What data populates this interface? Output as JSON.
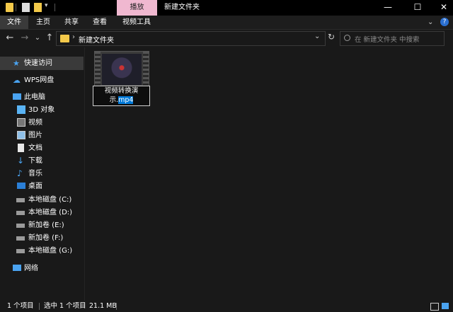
{
  "window": {
    "context_tab": "播放",
    "title": "新建文件夹",
    "minimize": "—",
    "maximize": "☐",
    "close": "✕"
  },
  "ribbon": {
    "tabs": [
      {
        "label": "文件",
        "active": true
      },
      {
        "label": "主页"
      },
      {
        "label": "共享"
      },
      {
        "label": "查看"
      },
      {
        "label": "视频工具"
      }
    ],
    "help": "?"
  },
  "address": {
    "back": "←",
    "forward": "→",
    "dropdown": "⌄",
    "up": "↑",
    "sep": "›",
    "path": "新建文件夹",
    "dropdown2": "⌄",
    "refresh": "↻",
    "search_placeholder": "在 新建文件夹 中搜索"
  },
  "sidebar": {
    "items": [
      {
        "label": "快速访问",
        "icon": "star-icon"
      },
      {
        "label": "WPS网盘",
        "icon": "cloud-icon"
      },
      {
        "label": "此电脑",
        "icon": "computer-icon"
      },
      {
        "label": "3D 对象",
        "icon": "cube-icon"
      },
      {
        "label": "视频",
        "icon": "video-icon"
      },
      {
        "label": "图片",
        "icon": "picture-icon"
      },
      {
        "label": "文档",
        "icon": "document-icon"
      },
      {
        "label": "下载",
        "icon": "download-icon"
      },
      {
        "label": "音乐",
        "icon": "music-icon"
      },
      {
        "label": "桌面",
        "icon": "desktop-icon"
      },
      {
        "label": "本地磁盘 (C:)",
        "icon": "drive-icon"
      },
      {
        "label": "本地磁盘 (D:)",
        "icon": "drive-icon"
      },
      {
        "label": "新加卷 (E:)",
        "icon": "drive-icon"
      },
      {
        "label": "新加卷 (F:)",
        "icon": "drive-icon"
      },
      {
        "label": "本地磁盘 (G:)",
        "icon": "drive-icon"
      },
      {
        "label": "网络",
        "icon": "network-icon"
      }
    ]
  },
  "file": {
    "name_line1": "视频转换演",
    "name_line2_plain": "示.",
    "name_line2_selected": "mp4"
  },
  "status": {
    "count": "1 个项目",
    "selected": "选中 1 个项目",
    "size": "21.1 MB"
  },
  "colors": {
    "accent": "#0078d7",
    "context_tab": "#f0b8d0",
    "folder": "#f3c94a"
  }
}
